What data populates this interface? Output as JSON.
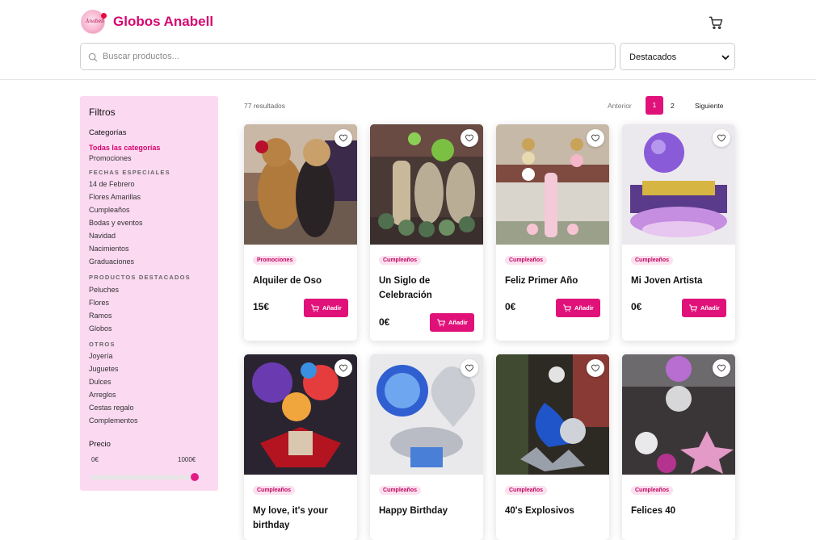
{
  "header": {
    "brand": "Globos Anabell",
    "logo_text": "Anabell",
    "search_placeholder": "Buscar productos...",
    "sort_selected": "Destacados"
  },
  "filters": {
    "title": "Filtros",
    "categories_label": "Categorías",
    "all_categories": "Todas las categorías",
    "promotions": "Promociones",
    "special_dates_heading": "FECHAS ESPECIALES",
    "special_dates": [
      "14 de Febrero",
      "Flores Amarillas",
      "Cumpleaños",
      "Bodas y eventos",
      "Navidad",
      "Nacimientos",
      "Graduaciones"
    ],
    "featured_heading": "PRODUCTOS DESTACADOS",
    "featured": [
      "Peluches",
      "Flores",
      "Ramos",
      "Globos"
    ],
    "others_heading": "OTROS",
    "others": [
      "Joyería",
      "Juguetes",
      "Dulces",
      "Arreglos",
      "Cestas regalo",
      "Complementos"
    ],
    "price_label": "Precio",
    "price_min": "0€",
    "price_max": "1000€",
    "price_slider_value": 1000
  },
  "results": {
    "count_text": "77 resultados"
  },
  "pagination": {
    "prev": "Anterior",
    "pages": [
      "1",
      "2"
    ],
    "current": "1",
    "next": "Siguiente"
  },
  "add_label": "Añadir",
  "products": [
    {
      "badge": "Promociones",
      "title": "Alquiler de Oso",
      "price": "15€"
    },
    {
      "badge": "Cumpleaños",
      "title": "Un Siglo de Celebración",
      "price": "0€"
    },
    {
      "badge": "Cumpleaños",
      "title": "Feliz Primer Año",
      "price": "0€"
    },
    {
      "badge": "Cumpleaños",
      "title": "Mi Joven Artista",
      "price": "0€"
    },
    {
      "badge": "Cumpleaños",
      "title": "My love, it's your birthday",
      "price": ""
    },
    {
      "badge": "Cumpleaños",
      "title": "Happy Birthday",
      "price": ""
    },
    {
      "badge": "Cumpleaños",
      "title": "40's Explosivos",
      "price": ""
    },
    {
      "badge": "Cumpleaños",
      "title": "Felices 40",
      "price": ""
    }
  ],
  "colors": {
    "accent": "#e0127a",
    "brand": "#d6066f",
    "filter_bg": "#fbd9f1",
    "badge_bg": "#fbe0ef"
  }
}
